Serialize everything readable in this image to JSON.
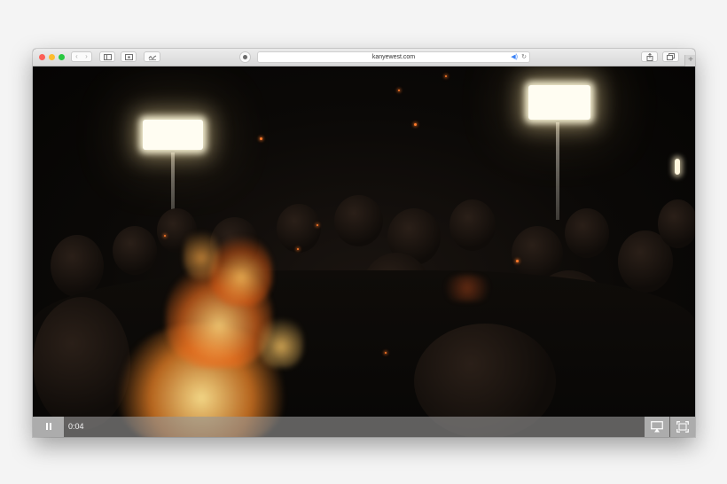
{
  "browser": {
    "url": "kanyewest.com",
    "icons": {
      "back": "chevron-left-icon",
      "forward": "chevron-right-icon",
      "sidebar": "sidebar-icon",
      "reader": "reader-icon",
      "extension": "signature-icon",
      "privacy": "privacy-icon",
      "audio": "speaker-icon",
      "reload": "reload-icon",
      "share": "share-icon",
      "tabs": "tabs-overview-icon",
      "new_tab": "plus-icon"
    },
    "colors": {
      "close": "#fc5f57",
      "minimize": "#fdbc2e",
      "zoom": "#28c840",
      "audio_accent": "#3b82f6"
    }
  },
  "player": {
    "current_time": "0:04",
    "icons": {
      "play_state": "pause-icon",
      "airplay": "airplay-icon",
      "fullscreen": "fullscreen-icon"
    }
  }
}
